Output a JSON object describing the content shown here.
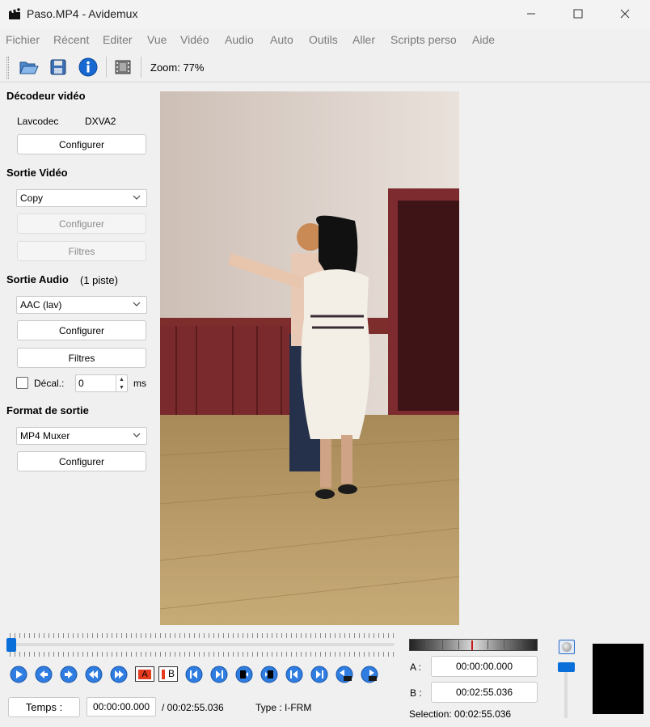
{
  "window": {
    "title": "Paso.MP4 - Avidemux"
  },
  "menu": [
    "Fichier",
    "Récent",
    "Editer",
    "Vue",
    "Vidéo",
    "Audio",
    "Auto",
    "Outils",
    "Aller",
    "Scripts perso",
    "Aide"
  ],
  "toolbar": {
    "zoom_label": "Zoom: 77%"
  },
  "decoder": {
    "title": "Décodeur vidéo",
    "codec": "Lavcodec",
    "accel": "DXVA2",
    "configure": "Configurer"
  },
  "video_out": {
    "title": "Sortie Vidéo",
    "selected": "Copy",
    "configure": "Configurer",
    "filters": "Filtres"
  },
  "audio_out": {
    "title": "Sortie Audio",
    "tracks": "(1 piste)",
    "selected": "AAC (lav)",
    "configure": "Configurer",
    "filters": "Filtres",
    "shift_label": "Décal.:",
    "shift_value": "0",
    "shift_unit": "ms"
  },
  "format": {
    "title": "Format de sortie",
    "selected": "MP4 Muxer",
    "configure": "Configurer"
  },
  "markers": {
    "a_label": "A",
    "b_label": "B"
  },
  "time": {
    "button": "Temps :",
    "current": "00:00:00.000",
    "total": "/ 00:02:55.036",
    "type": "Type : I-FRM",
    "a_prefix": "A :",
    "a_value": "00:00:00.000",
    "b_prefix": "B :",
    "b_value": "00:02:55.036",
    "selection": "Selection: 00:02:55.036"
  },
  "colors": {
    "accent": "#0a6fd8",
    "marker_a": "#e53b1f"
  }
}
